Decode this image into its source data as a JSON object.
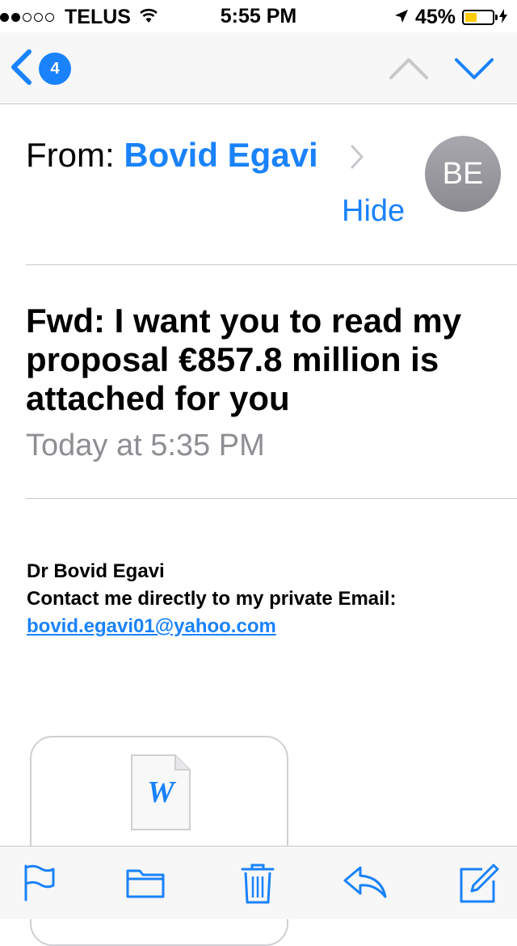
{
  "status_bar": {
    "carrier": "TELUS",
    "time": "5:55 PM",
    "battery_percent": "45%",
    "battery_level": 0.45,
    "signal_bars": 2,
    "icons": [
      "wifi-icon",
      "location-arrow-icon",
      "charging-bolt-icon"
    ]
  },
  "nav": {
    "back_count": "4",
    "icons": [
      "back-chevron-icon",
      "up-chevron-icon",
      "down-chevron-icon"
    ]
  },
  "header": {
    "from_label": "From:",
    "sender_name": "Bovid Egavi",
    "avatar_initials": "BE",
    "hide_label": "Hide"
  },
  "message": {
    "subject": "Fwd: I want you to read my proposal €857.8 million is attached for you",
    "date": "Today at 5:35 PM",
    "body_line1": "Dr Bovid Egavi",
    "body_line2": "Contact me directly to my private Email:",
    "email_link": "bovid.egavi01@yahoo.com"
  },
  "attachment": {
    "icon_letter": "W",
    "icon": "word-document-icon"
  },
  "toolbar": {
    "icons": [
      "flag-icon",
      "folder-icon",
      "trash-icon",
      "reply-icon",
      "compose-icon"
    ]
  },
  "colors": {
    "accent": "#1a82fb",
    "battery": "#ffcc00",
    "secondary_text": "#8e8e93"
  }
}
